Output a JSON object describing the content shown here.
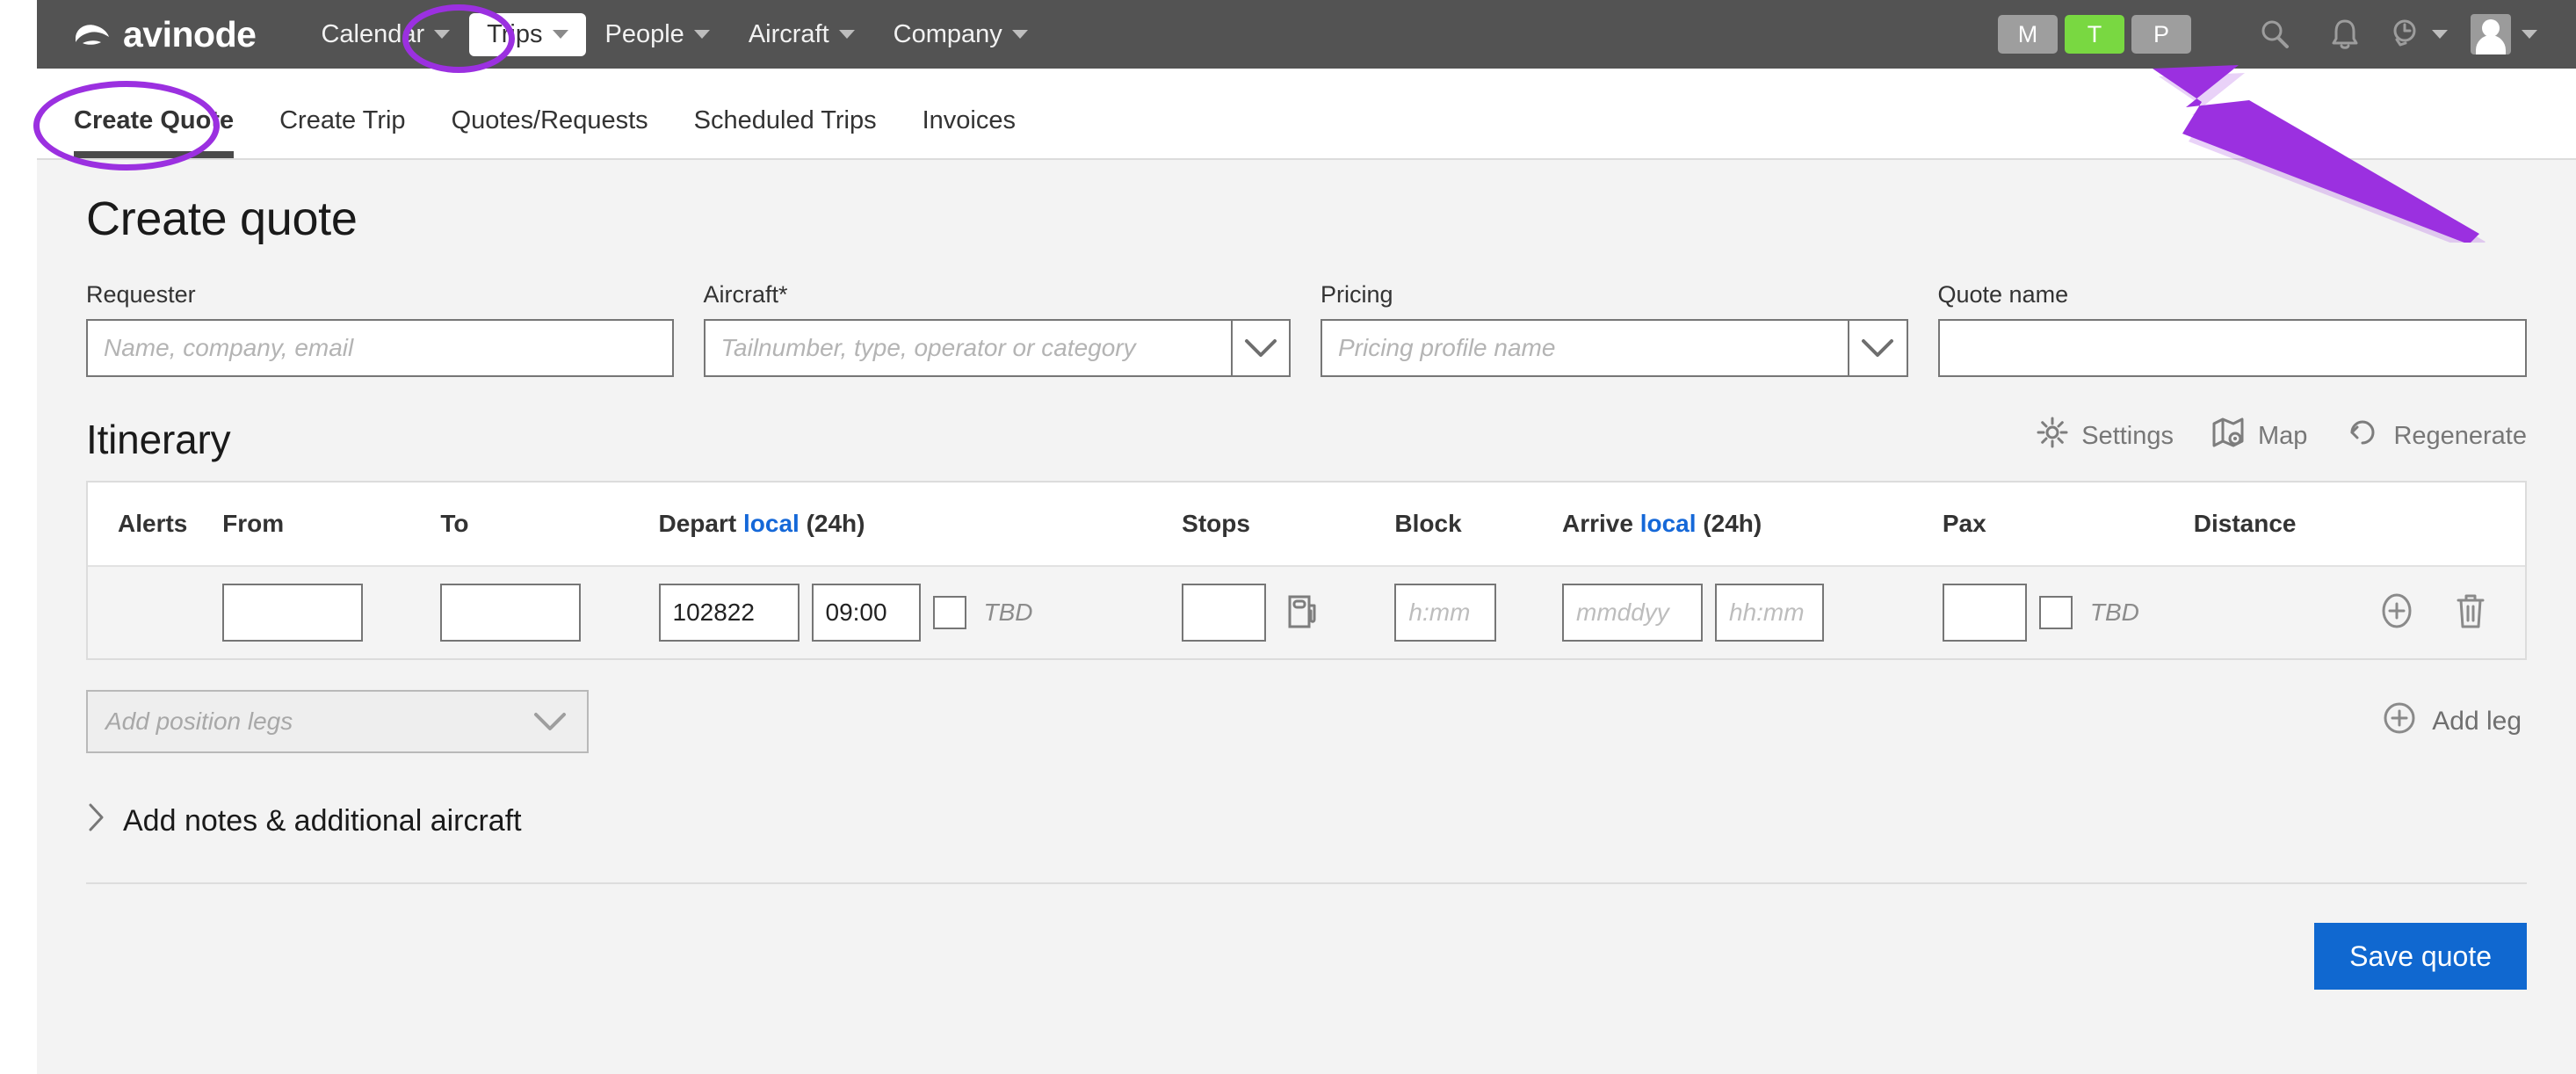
{
  "brand": {
    "name": "avinode",
    "mark_icon": "avinode-logo-icon"
  },
  "topnav": {
    "items": [
      {
        "label": "Calendar",
        "caret": true,
        "active": false
      },
      {
        "label": "Trips",
        "caret": true,
        "active": true
      },
      {
        "label": "People",
        "caret": true,
        "active": false
      },
      {
        "label": "Aircraft",
        "caret": true,
        "active": false
      },
      {
        "label": "Company",
        "caret": true,
        "active": false
      }
    ],
    "badges": [
      {
        "label": "M",
        "color": "#9e9e9e"
      },
      {
        "label": "T",
        "color": "#79d841"
      },
      {
        "label": "P",
        "color": "#9e9e9e"
      }
    ],
    "icons": [
      {
        "name": "search-icon"
      },
      {
        "name": "bell-icon"
      },
      {
        "name": "history-clock-icon"
      },
      {
        "name": "avatar-icon"
      }
    ]
  },
  "subtabs": [
    {
      "label": "Create Quote",
      "active": true
    },
    {
      "label": "Create Trip",
      "active": false
    },
    {
      "label": "Quotes/Requests",
      "active": false
    },
    {
      "label": "Scheduled Trips",
      "active": false
    },
    {
      "label": "Invoices",
      "active": false
    }
  ],
  "page": {
    "title": "Create quote"
  },
  "form": {
    "requester": {
      "label": "Requester",
      "value": "",
      "placeholder": "Name, company, email"
    },
    "aircraft": {
      "label": "Aircraft*",
      "value": "",
      "placeholder": "Tailnumber, type, operator or category"
    },
    "pricing": {
      "label": "Pricing",
      "value": "",
      "placeholder": "Pricing profile name"
    },
    "quote_name": {
      "label": "Quote name",
      "value": "",
      "placeholder": ""
    }
  },
  "itinerary": {
    "title": "Itinerary",
    "actions": [
      {
        "label": "Settings",
        "icon": "gear-icon"
      },
      {
        "label": "Map",
        "icon": "map-pin-icon"
      },
      {
        "label": "Regenerate",
        "icon": "refresh-icon"
      }
    ],
    "columns": {
      "alerts": "Alerts",
      "from": "From",
      "to": "To",
      "depart_prefix": "Depart",
      "depart_link": "local",
      "depart_suffix": "(24h)",
      "stops": "Stops",
      "block": "Block",
      "arrive_prefix": "Arrive",
      "arrive_link": "local",
      "arrive_suffix": "(24h)",
      "pax": "Pax",
      "distance": "Distance"
    },
    "rows": [
      {
        "from": "",
        "to": "",
        "depart_date": "102822",
        "depart_time": "09:00",
        "depart_tbd_label": "TBD",
        "depart_tbd_checked": false,
        "stops": "",
        "fuel_icon": "fuel-pump-icon",
        "block": "",
        "block_placeholder": "h:mm",
        "arrive_date": "",
        "arrive_date_placeholder": "mmddyy",
        "arrive_time": "",
        "arrive_time_placeholder": "hh:mm",
        "pax": "",
        "pax_tbd_label": "TBD",
        "pax_tbd_checked": false,
        "distance": "",
        "add_icon": "plus-circle-icon",
        "delete_icon": "trash-icon"
      }
    ],
    "position_legs": {
      "placeholder": "Add position legs",
      "value": ""
    },
    "add_leg": {
      "label": "Add leg",
      "icon": "plus-circle-icon"
    }
  },
  "notes": {
    "label": "Add notes & additional aircraft",
    "icon": "chevron-right-icon"
  },
  "footer": {
    "save_label": "Save quote"
  },
  "colors": {
    "topbar_bg": "#535353",
    "accent_blue": "#1068d0",
    "link_blue": "#1568d8",
    "badge_green": "#79d841",
    "annotation_purple": "#9b30e0",
    "content_bg": "#f3f3f3"
  }
}
